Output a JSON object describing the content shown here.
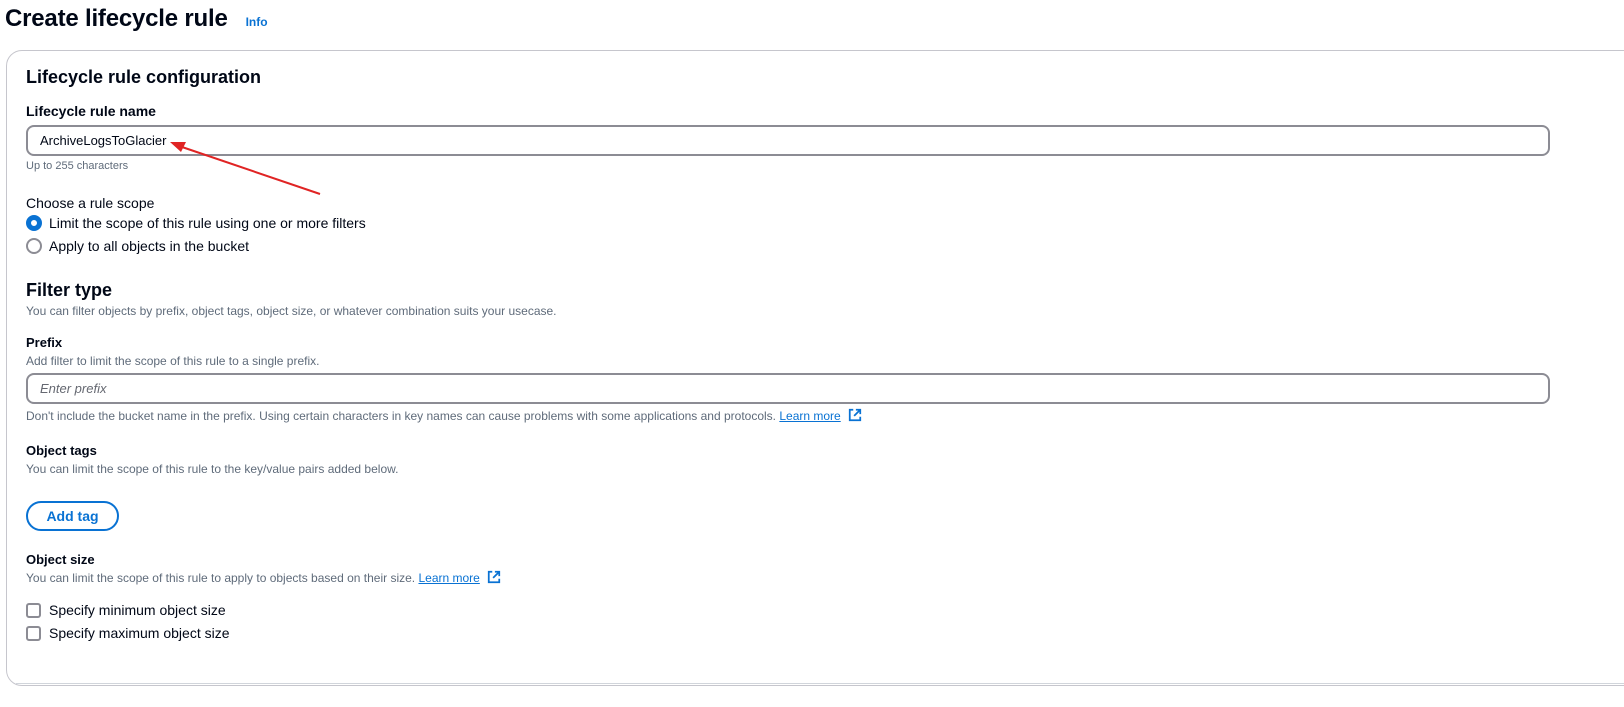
{
  "header": {
    "title": "Create lifecycle rule",
    "info": "Info"
  },
  "config": {
    "title": "Lifecycle rule configuration",
    "rule_name": {
      "label": "Lifecycle rule name",
      "value": "ArchiveLogsToGlacier",
      "hint": "Up to 255 characters"
    },
    "scope": {
      "label": "Choose a rule scope",
      "options": [
        {
          "label": "Limit the scope of this rule using one or more filters",
          "checked": true
        },
        {
          "label": "Apply to all objects in the bucket",
          "checked": false
        }
      ]
    },
    "filter": {
      "title": "Filter type",
      "desc": "You can filter objects by prefix, object tags, object size, or whatever combination suits your usecase.",
      "prefix": {
        "label": "Prefix",
        "desc": "Add filter to limit the scope of this rule to a single prefix.",
        "placeholder": "Enter prefix",
        "value": "",
        "hint": "Don't include the bucket name in the prefix. Using certain characters in key names can cause problems with some applications and protocols.",
        "link": "Learn more"
      },
      "tags": {
        "label": "Object tags",
        "desc": "You can limit the scope of this rule to the key/value pairs added below.",
        "button": "Add tag"
      },
      "size": {
        "label": "Object size",
        "desc": "You can limit the scope of this rule to apply to objects based on their size.",
        "link": "Learn more",
        "options": [
          {
            "label": "Specify minimum object size",
            "checked": false
          },
          {
            "label": "Specify maximum object size",
            "checked": false
          }
        ]
      }
    }
  },
  "icons": {
    "external": "external-link-icon",
    "annotation": "red-arrow-annotation"
  },
  "colors": {
    "accent": "#0972d3",
    "annotation": "#e02424"
  }
}
